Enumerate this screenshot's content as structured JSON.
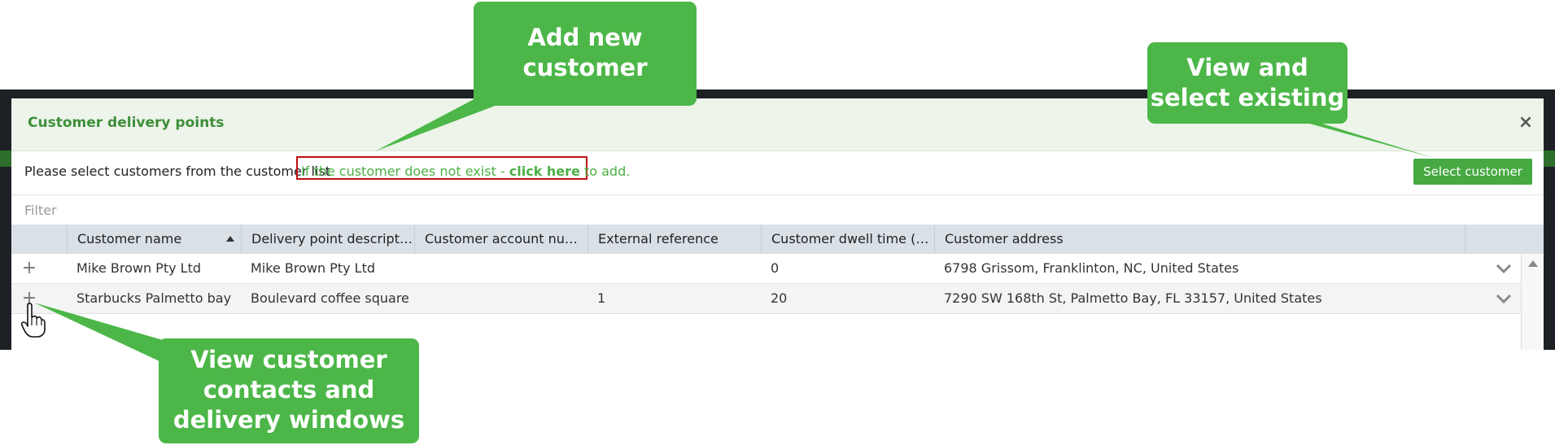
{
  "modal": {
    "title": "Customer delivery points",
    "close_label": "×",
    "instruction": "Please select customers from the customer list",
    "add_link": {
      "prefix": "If the customer does not exist - ",
      "emphasis": "click here",
      "suffix": " to add."
    },
    "select_button": "Select customer",
    "filter_placeholder": "Filter"
  },
  "grid": {
    "columns": [
      "Customer name",
      "Delivery point description",
      "Customer account num...",
      "External reference",
      "Customer dwell time (mi...",
      "Customer address"
    ],
    "sorted_column": "Customer name",
    "sort_direction": "ascending",
    "rows": [
      {
        "expand": "+",
        "name": "Mike Brown Pty Ltd",
        "description": "Mike Brown Pty Ltd",
        "account": "",
        "reference": "",
        "dwell": "0",
        "address": "6798 Grissom, Franklinton, NC, United States"
      },
      {
        "expand": "+",
        "name": "Starbucks Palmetto bay",
        "description": "Boulevard coffee square",
        "account": "",
        "reference": "1",
        "dwell": "20",
        "address": "7290 SW 168th St, Palmetto Bay, FL 33157, United States"
      }
    ]
  },
  "callouts": {
    "add_new": "Add new customer",
    "view_select": "View and select existing",
    "view_contacts": "View customer contacts and delivery windows"
  },
  "colors": {
    "accent": "#47a942",
    "callout": "#4cb748",
    "highlight_border": "#c01010",
    "header_bg": "#edf4ea",
    "grid_header_bg": "#d9e0e6"
  },
  "icons": {
    "close": "close-icon",
    "expand": "plus-icon",
    "row_menu": "chevron-down-icon",
    "sort": "sort-ascending-icon",
    "cursor": "hand-pointer-icon"
  }
}
